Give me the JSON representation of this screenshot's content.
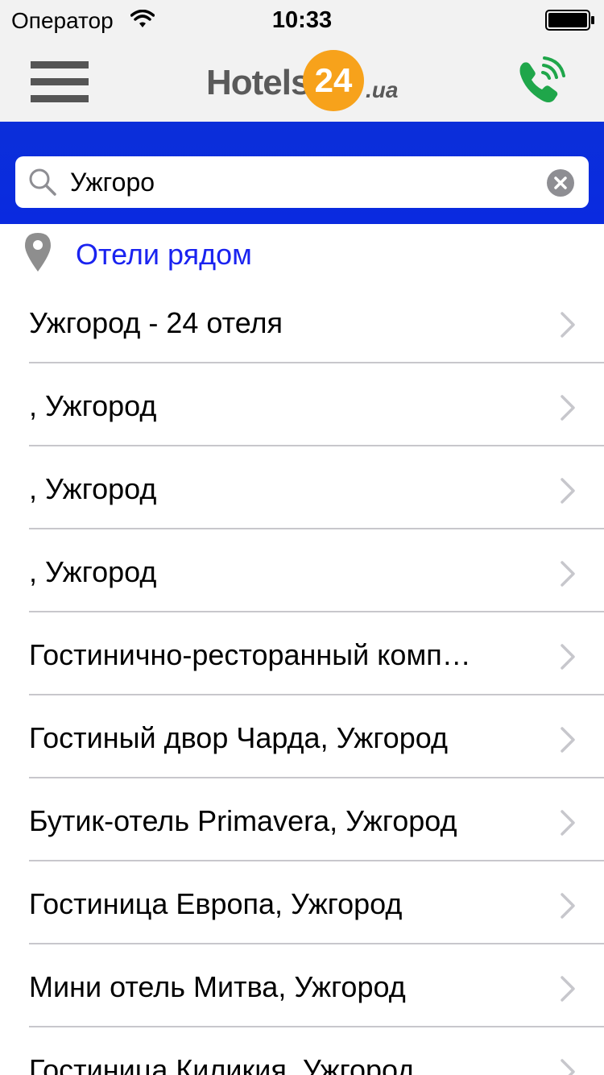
{
  "status_bar": {
    "carrier": "Оператор",
    "time": "10:33"
  },
  "header": {
    "logo_word": "Hotels",
    "logo_number": "24",
    "logo_tld": ".ua",
    "logo_color_orange": "#f7a21b",
    "phone_color": "#1fa64a"
  },
  "search": {
    "value": "Ужгоро",
    "background_color": "#0b2fd9"
  },
  "nearby": {
    "label": "Отели рядом",
    "color": "#1a23f0"
  },
  "results": [
    {
      "label": "Ужгород - 24 отеля"
    },
    {
      "label": " , Ужгород"
    },
    {
      "label": " , Ужгород"
    },
    {
      "label": " , Ужгород"
    },
    {
      "label": "Гостинично-ресторанный комп…"
    },
    {
      "label": "Гостиный двор Чарда, Ужгород"
    },
    {
      "label": "Бутик-отель Primavera, Ужгород"
    },
    {
      "label": "Гостиница Европа, Ужгород"
    },
    {
      "label": "Мини отель Митва, Ужгород"
    },
    {
      "label": "Гостиница Киликия, Ужгород"
    }
  ]
}
